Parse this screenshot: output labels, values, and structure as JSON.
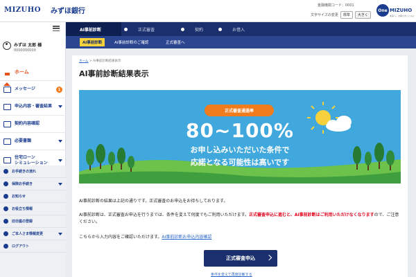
{
  "header": {
    "brand_mizuho": "MIZUHO",
    "brand_bank": "みずほ銀行",
    "financial_code": "金融機関コード：0001",
    "font_size_label": "文字サイズの変更",
    "font_standard": "標準",
    "font_large": "大きく",
    "one_mizuho_circle": "One",
    "one_mizuho_text": "MIZUHO",
    "one_mizuho_sub": "未来へ。お客さまとともに"
  },
  "user": {
    "name": "みずほ 太郎 様",
    "id": "0000000000"
  },
  "sidebar": {
    "items": [
      {
        "label": "ホーム",
        "icon": "home-icon"
      },
      {
        "label": "メッセージ",
        "icon": "message-icon",
        "badge": "1"
      },
      {
        "label": "申込内容・審査結果",
        "icon": "document-icon"
      },
      {
        "label": "契約内容確認",
        "icon": "contract-icon"
      },
      {
        "label": "必要書類",
        "icon": "file-icon"
      },
      {
        "label_line1": "住宅ローン",
        "label_line2": "シミュレーション",
        "icon": "chart-icon"
      }
    ],
    "sub_items": [
      {
        "label": "お手続きの流れ"
      },
      {
        "label": "保険お手続き"
      },
      {
        "label": "お知らせ"
      },
      {
        "label": "お役立ち情報"
      },
      {
        "label": "旧日座の登録"
      },
      {
        "label": "ご本人さま情報変更"
      },
      {
        "label": "ログアウト"
      }
    ]
  },
  "steps": [
    {
      "label": "AI事前診断"
    },
    {
      "label": "正式審査"
    },
    {
      "label": "契約"
    },
    {
      "label": "お借入"
    }
  ],
  "sub_tabs": [
    {
      "label": "AI事前診断"
    },
    {
      "label": "AI事前診断のご確認"
    },
    {
      "label": "正式審査へ"
    }
  ],
  "breadcrumb": {
    "home": "ホーム",
    "current": "AI事前診断結果表示"
  },
  "page_title": "AI事前診断結果表示",
  "banner": {
    "pill": "正式審査通過率",
    "rate": "80~100%",
    "line1": "お申し込みいただいた条件で",
    "line2": "応諾となる可能性は高いです",
    "colors": {
      "sky": "#40a8dc",
      "grass": "#48b14a",
      "pill": "#f07c1e"
    }
  },
  "body": {
    "p1": "AI事前診断の結果は上記の通りです。正式審査のお申込をお待ちしております。",
    "p2_a": "AI事前診断は、正式審査お申込を行うまでは、条件を変えて何度でもご利用いただけます。",
    "p2_red": "正式審査申込に進むと、AI事前診断はご利用いただけなくなります",
    "p2_b": "ので、ご注意ください。",
    "p3_a": "こちらから入力内容をご確認いただけます。",
    "p3_link": "AI事前診断お申込内容確認"
  },
  "cta_label": "正式審査申込",
  "back_link": "条件を変えて再度診断する"
}
